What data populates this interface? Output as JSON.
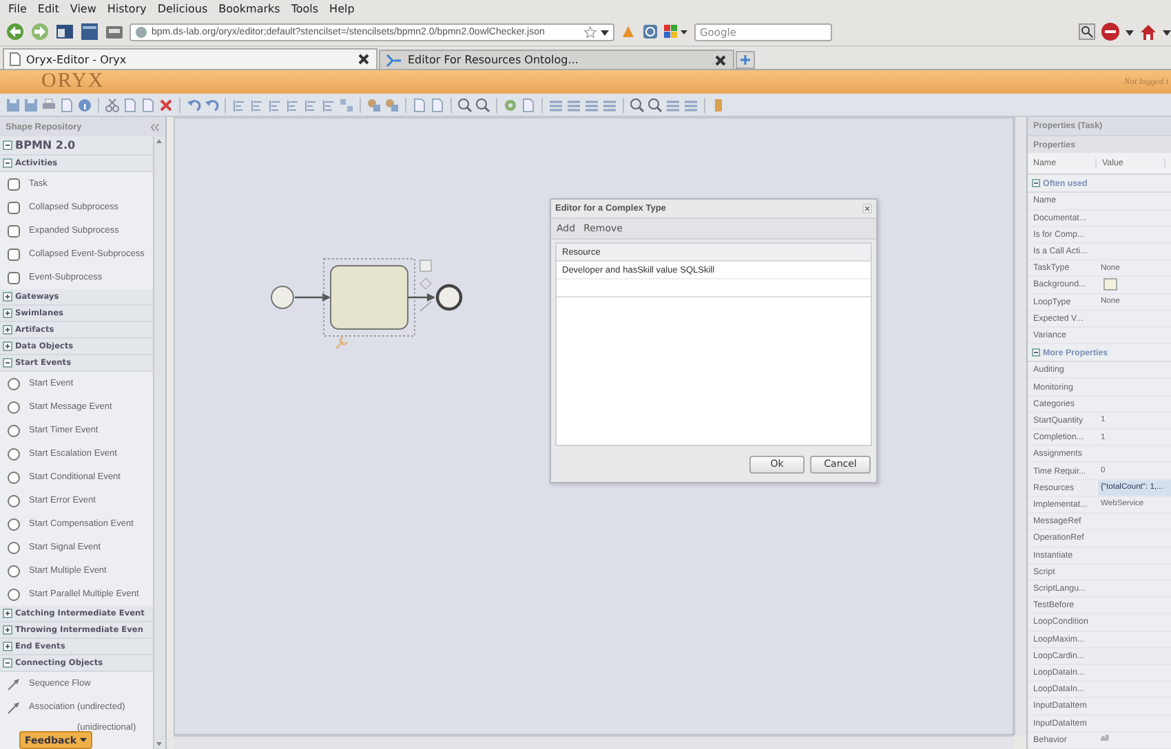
{
  "browser": {
    "menu": [
      "File",
      "Edit",
      "View",
      "History",
      "Delicious",
      "Bookmarks",
      "Tools",
      "Help"
    ],
    "url": "bpm.ds-lab.org/oryx/editor;default?stencilset=/stencilsets/bpmn2.0/bpmn2.0owlChecker.json",
    "search": {
      "placeholder": "Google"
    },
    "tabs": [
      {
        "label": "Oryx-Editor - Oryx",
        "selected": true
      },
      {
        "label": "Editor For Resources Ontolog...",
        "selected": false
      }
    ]
  },
  "app": {
    "logo": "ORYX",
    "login": "Not logged i"
  },
  "shape_repository": {
    "title": "Shape Repository",
    "groups": [
      {
        "label": "BPMN 2.0",
        "expanded": true,
        "children": [
          {
            "label": "Activities",
            "expanded": true,
            "children": [
              {
                "label": "Task",
                "kind": "task"
              },
              {
                "label": "Collapsed Subprocess",
                "kind": "task"
              },
              {
                "label": "Expanded Subprocess",
                "kind": "task"
              },
              {
                "label": "Collapsed Event-Subprocess",
                "kind": "task"
              },
              {
                "label": "Event-Subprocess",
                "kind": "task"
              }
            ]
          },
          {
            "label": "Gateways",
            "expanded": false
          },
          {
            "label": "Swimlanes",
            "expanded": false
          },
          {
            "label": "Artifacts",
            "expanded": false
          },
          {
            "label": "Data Objects",
            "expanded": false
          },
          {
            "label": "Start Events",
            "expanded": true,
            "children": [
              {
                "label": "Start Event",
                "kind": "event"
              },
              {
                "label": "Start Message Event",
                "kind": "event"
              },
              {
                "label": "Start Timer Event",
                "kind": "event"
              },
              {
                "label": "Start Escalation Event",
                "kind": "event"
              },
              {
                "label": "Start Conditional Event",
                "kind": "event"
              },
              {
                "label": "Start Error Event",
                "kind": "event"
              },
              {
                "label": "Start Compensation Event",
                "kind": "event"
              },
              {
                "label": "Start Signal Event",
                "kind": "event"
              },
              {
                "label": "Start Multiple Event",
                "kind": "event"
              },
              {
                "label": "Start Parallel Multiple Event",
                "kind": "event"
              }
            ]
          },
          {
            "label": "Catching Intermediate Event",
            "expanded": false
          },
          {
            "label": "Throwing Intermediate Even",
            "expanded": false
          },
          {
            "label": "End Events",
            "expanded": false
          },
          {
            "label": "Connecting Objects",
            "expanded": true,
            "children": [
              {
                "label": "Sequence Flow",
                "kind": "flow"
              },
              {
                "label": "Association (undirected)",
                "kind": "flow"
              },
              {
                "label": "(unidirectional)",
                "kind": "covered"
              }
            ]
          }
        ]
      }
    ],
    "feedback": "Feedback"
  },
  "dialog": {
    "title": "Editor for a Complex Type",
    "actions": [
      "Add",
      "Remove"
    ],
    "columns": [
      "Resource"
    ],
    "rows": [
      "Developer and hasSkill value SQLSkill"
    ],
    "buttons": [
      "Ok",
      "Cancel"
    ]
  },
  "properties": {
    "title": "Properties (Task)",
    "subtitle": "Properties",
    "columns": [
      "Name",
      "Value"
    ],
    "groups": [
      {
        "label": "Often used",
        "expanded": true,
        "rows": [
          {
            "name": "Name",
            "kind": "text",
            "selected": false
          },
          {
            "name": "Documentat...",
            "kind": "text",
            "selected": false
          },
          {
            "name": "Is for Comp...",
            "kind": "text",
            "selected": false
          },
          {
            "name": "Is a Call Acti...",
            "kind": "text",
            "selected": false
          },
          {
            "name": "TaskType",
            "value": "None",
            "kind": "text",
            "selected": false
          },
          {
            "name": "Background...",
            "kind": "swatch",
            "selected": false
          },
          {
            "name": "LoopType",
            "value": "None",
            "kind": "text",
            "selected": false
          },
          {
            "name": "Expected V...",
            "kind": "text",
            "selected": false
          },
          {
            "name": "Variance",
            "kind": "text",
            "selected": false
          }
        ]
      },
      {
        "label": "More Properties",
        "expanded": true,
        "rows": [
          {
            "name": "Auditing",
            "kind": "text",
            "selected": false
          },
          {
            "name": "Monitoring",
            "kind": "text",
            "selected": false
          },
          {
            "name": "Categories",
            "kind": "text",
            "selected": false
          },
          {
            "name": "StartQuantity",
            "value": "1",
            "kind": "text",
            "selected": false
          },
          {
            "name": "Completion...",
            "value": "1",
            "kind": "text",
            "selected": false
          },
          {
            "name": "Assignments",
            "kind": "text",
            "selected": false
          },
          {
            "name": "Time Requir...",
            "value": "0",
            "kind": "text",
            "selected": false
          },
          {
            "name": "Resources",
            "value": "{\"totalCount\": 1,...",
            "kind": "text",
            "selected": true
          },
          {
            "name": "Implementat...",
            "value": "WebService",
            "kind": "text",
            "selected": false
          },
          {
            "name": "MessageRef",
            "kind": "text",
            "selected": false
          },
          {
            "name": "OperationRef",
            "kind": "text",
            "selected": false
          },
          {
            "name": "Instantiate",
            "kind": "text",
            "selected": false
          },
          {
            "name": "Script",
            "kind": "text",
            "selected": false
          },
          {
            "name": "ScriptLangu...",
            "kind": "text",
            "selected": false
          },
          {
            "name": "TestBefore",
            "kind": "text",
            "selected": false
          },
          {
            "name": "LoopCondition",
            "kind": "text",
            "selected": false
          },
          {
            "name": "LoopMaxim...",
            "kind": "text",
            "selected": false
          },
          {
            "name": "LoopCardin...",
            "kind": "text",
            "selected": false
          },
          {
            "name": "LoopDataIn...",
            "kind": "text",
            "selected": false
          },
          {
            "name": "LoopDataIn...",
            "kind": "text",
            "selected": false
          },
          {
            "name": "InputDataItem",
            "kind": "text",
            "selected": false
          },
          {
            "name": "InputDataItem",
            "kind": "text",
            "selected": false
          },
          {
            "name": "Behavior",
            "value": "all",
            "kind": "text",
            "selected": false
          }
        ]
      }
    ]
  }
}
